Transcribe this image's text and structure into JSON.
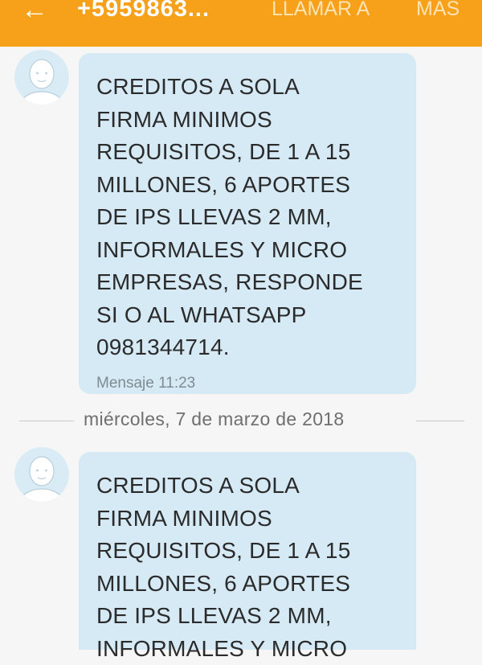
{
  "header": {
    "contact": "+5959863...",
    "call_label": "LLAMAR A",
    "more_label": "MÁS",
    "back_icon": "back-arrow-icon",
    "bar_color": "#f7a019"
  },
  "messages": [
    {
      "lines": [
        "CREDITOS A SOLA",
        "FIRMA MINIMOS",
        "REQUISITOS, DE 1 A 15",
        "MILLONES, 6 APORTES",
        "DE IPS LLEVAS 2 MM,",
        "INFORMALES Y MICRO",
        "EMPRESAS, RESPONDE",
        "SI O AL WHATSAPP",
        "0981344714."
      ],
      "meta": "Mensaje 11:23"
    },
    {
      "lines": [
        "CREDITOS A SOLA",
        "FIRMA MINIMOS",
        "REQUISITOS, DE 1 A 15",
        "MILLONES, 6 APORTES",
        "DE IPS LLEVAS 2 MM,",
        "INFORMALES Y MICRO"
      ]
    }
  ],
  "date_divider": "miércoles, 7 de marzo de 2018",
  "colors": {
    "bubble": "#d6eaf5",
    "avatar": "#d9ecf6"
  }
}
